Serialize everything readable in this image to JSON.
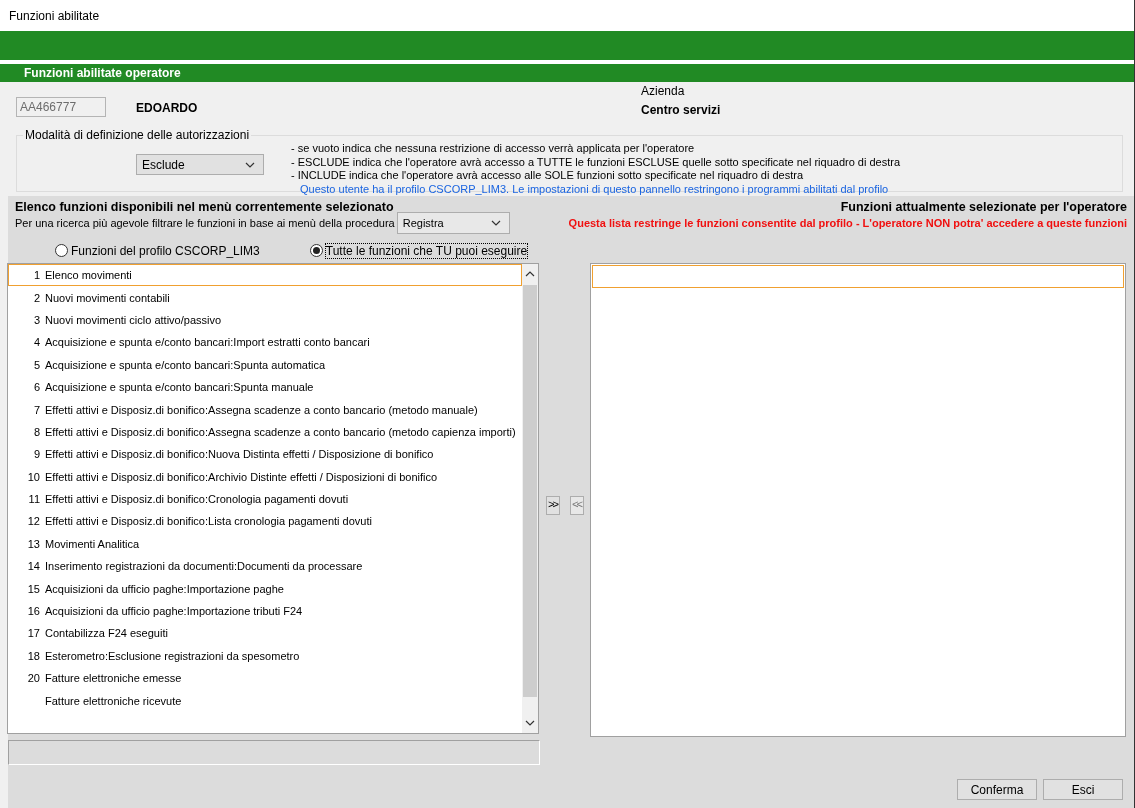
{
  "window": {
    "title": "Funzioni abilitate"
  },
  "header": {
    "title": "Funzioni abilitate operatore"
  },
  "operator": {
    "code": "AA466777",
    "name": "EDOARDO"
  },
  "company": {
    "label": "Azienda",
    "name": "Centro servizi"
  },
  "authorization": {
    "legend": "Modalità di definizione delle autorizzazioni",
    "mode": "Esclude",
    "notes": [
      "- se vuoto indica che nessuna restrizione di accesso verrà applicata per l'operatore",
      "- ESCLUDE indica che l'operatore avrà accesso a TUTTE le funzioni ESCLUSE quelle sotto specificate nel riquadro di destra",
      "- INCLUDE indica che l'operatore avrà accesso alle SOLE funzioni sotto specificate nel riquadro di destra"
    ],
    "profile_note": "Questo utente ha il profilo CSCORP_LIM3. Le impostazioni di questo pannello restringono i programmi abilitati dal profilo"
  },
  "available": {
    "title": "Elenco funzioni disponibili nel menù correntemente selezionato",
    "filter_label": "Per una ricerca più agevole filtrare le funzioni in base ai menù della procedura",
    "filter": "Registra",
    "options": [
      {
        "label": "Funzioni del profilo CSCORP_LIM3",
        "selected": false
      },
      {
        "label": "Tutte le funzioni che TU puoi eseguire",
        "selected": true
      }
    ],
    "items": [
      {
        "number": "1",
        "label": "Elenco movimenti",
        "selected": true
      },
      {
        "number": "2",
        "label": "Nuovi movimenti contabili",
        "selected": false
      },
      {
        "number": "3",
        "label": "Nuovi movimenti ciclo attivo/passivo",
        "selected": false
      },
      {
        "number": "4",
        "label": "Acquisizione e spunta e/conto bancari:Import estratti conto bancari",
        "selected": false
      },
      {
        "number": "5",
        "label": "Acquisizione e spunta e/conto bancari:Spunta automatica",
        "selected": false
      },
      {
        "number": "6",
        "label": "Acquisizione e spunta e/conto bancari:Spunta manuale",
        "selected": false
      },
      {
        "number": "7",
        "label": "Effetti attivi e Disposiz.di bonifico:Assegna scadenze a conto bancario (metodo manuale)",
        "selected": false
      },
      {
        "number": "8",
        "label": "Effetti attivi e Disposiz.di bonifico:Assegna scadenze a conto bancario (metodo capienza importi)",
        "selected": false
      },
      {
        "number": "9",
        "label": "Effetti attivi e Disposiz.di bonifico:Nuova Distinta effetti / Disposizione di bonifico",
        "selected": false
      },
      {
        "number": "10",
        "label": "Effetti attivi e Disposiz.di bonifico:Archivio Distinte effetti / Disposizioni di bonifico",
        "selected": false
      },
      {
        "number": "11",
        "label": "Effetti attivi e Disposiz.di bonifico:Cronologia pagamenti dovuti",
        "selected": false
      },
      {
        "number": "12",
        "label": "Effetti attivi e Disposiz.di bonifico:Lista cronologia pagamenti dovuti",
        "selected": false
      },
      {
        "number": "13",
        "label": "Movimenti Analitica",
        "selected": false
      },
      {
        "number": "14",
        "label": "Inserimento registrazioni da documenti:Documenti da processare",
        "selected": false
      },
      {
        "number": "15",
        "label": "Acquisizioni da ufficio paghe:Importazione paghe",
        "selected": false
      },
      {
        "number": "16",
        "label": "Acquisizioni da ufficio paghe:Importazione tributi F24",
        "selected": false
      },
      {
        "number": "17",
        "label": "Contabilizza F24 eseguiti",
        "selected": false
      },
      {
        "number": "18",
        "label": "Esterometro:Esclusione registrazioni da spesometro",
        "selected": false
      },
      {
        "number": "20",
        "label": "Fatture elettroniche emesse",
        "selected": false
      },
      {
        "label": "Fatture elettroniche ricevute",
        "selected": false
      }
    ]
  },
  "transfer_buttons": [
    {
      "label": ">>",
      "disabled": false
    },
    {
      "label": "<<",
      "disabled": true
    }
  ],
  "selected_functions": {
    "title": "Funzioni attualmente selezionate per l'operatore",
    "warning": "Questa lista restringe le funzioni consentite dal profilo - L'operatore NON potra' accedere a queste funzioni"
  },
  "buttons": [
    "Conferma",
    "Esci"
  ]
}
